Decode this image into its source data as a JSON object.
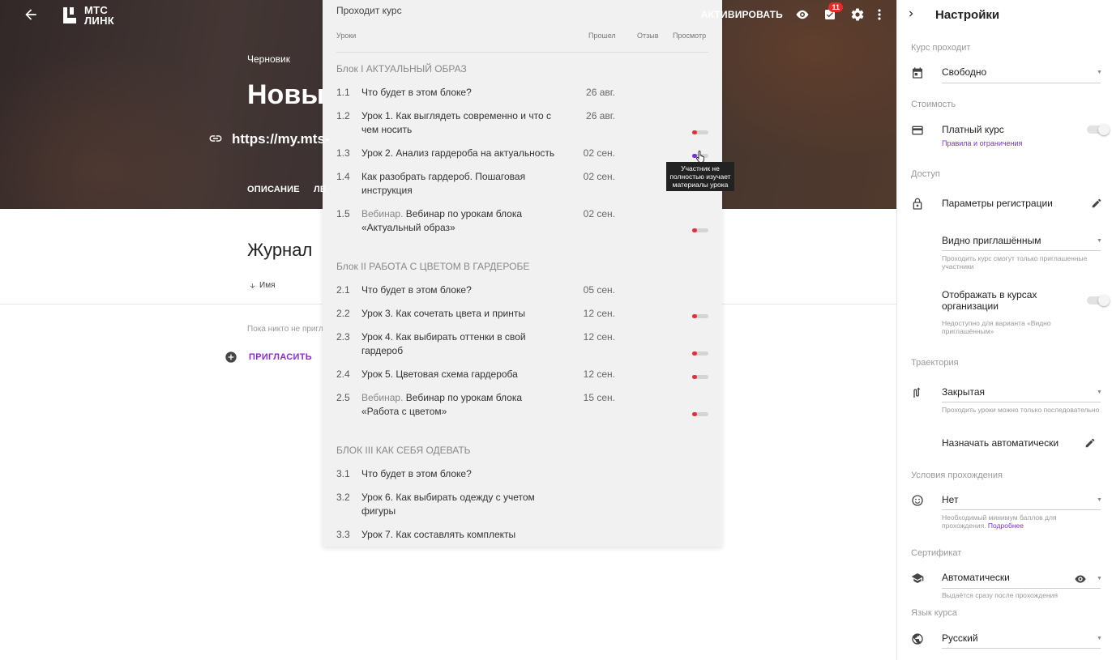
{
  "hero": {
    "logo": [
      "МТС",
      "ЛИНК"
    ],
    "draft_label": "Черновик",
    "course_title": "Новы",
    "course_url": "https://my.mts-",
    "tabs": [
      "ОПИСАНИЕ",
      "ЛЕ"
    ],
    "activate_label": "АКТИВИРОВАТЬ",
    "notification_count": "11"
  },
  "main": {
    "journal_title": "Журнал",
    "sort_label": "Имя",
    "empty_text": "Пока никто не пригл",
    "invite_label": "ПРИГЛАСИТЬ"
  },
  "panel": {
    "title": "Проходит курс",
    "columns": {
      "lessons": "Уроки",
      "passed": "Прошел",
      "feedback": "Отзыв",
      "view": "Просмотр"
    },
    "blocks": [
      {
        "title": "Блок I АКТУАЛЬНЫЙ ОБРАЗ",
        "lessons": [
          {
            "num": "1.1",
            "tag": "",
            "name": "Что будет в этом блоке?",
            "date": "26 авг.",
            "toggle": false
          },
          {
            "num": "1.2",
            "tag": "",
            "name": "Урок 1. Как выглядеть современно и что с чем носить",
            "date": "26 авг.",
            "toggle": true
          },
          {
            "num": "1.3",
            "tag": "",
            "name": "Урок 2. Анализ гардероба на актуальность",
            "date": "02 сен.",
            "toggle": true,
            "active": true
          },
          {
            "num": "1.4",
            "tag": "",
            "name": "Как разобрать гардероб. Пошаговая инструкция",
            "date": "02 сен.",
            "toggle": false
          },
          {
            "num": "1.5",
            "tag": "Вебинар.",
            "name": "Вебинар по урокам блока «Актуальный образ»",
            "date": "02 сен.",
            "toggle": true
          }
        ]
      },
      {
        "title": "Блок II РАБОТА С ЦВЕТОМ В ГАРДЕРОБЕ",
        "lessons": [
          {
            "num": "2.1",
            "tag": "",
            "name": "Что будет в этом блоке?",
            "date": "05 сен.",
            "toggle": false
          },
          {
            "num": "2.2",
            "tag": "",
            "name": "Урок 3. Как сочетать цвета и принты",
            "date": "12 сен.",
            "toggle": true
          },
          {
            "num": "2.3",
            "tag": "",
            "name": "Урок 4. Как выбирать оттенки в свой гардероб",
            "date": "12 сен.",
            "toggle": true
          },
          {
            "num": "2.4",
            "tag": "",
            "name": "Урок 5. Цветовая схема гардероба",
            "date": "12 сен.",
            "toggle": true
          },
          {
            "num": "2.5",
            "tag": "Вебинар.",
            "name": "Вебинар по урокам блока «Работа с цветом»",
            "date": "15 сен.",
            "toggle": true
          }
        ]
      },
      {
        "title": "БЛОК III КАК СЕБЯ ОДЕВАТЬ",
        "lessons": [
          {
            "num": "3.1",
            "tag": "",
            "name": "Что будет в этом блоке?",
            "date": "",
            "toggle": false
          },
          {
            "num": "3.2",
            "tag": "",
            "name": "Урок 6. Как выбирать одежду с учетом фигуры",
            "date": "",
            "toggle": false
          },
          {
            "num": "3.3",
            "tag": "",
            "name": "Урок 7. Как составлять комплекты",
            "date": "",
            "toggle": false
          }
        ]
      }
    ],
    "tooltip": "Участник не полностью изучает материалы урока"
  },
  "settings": {
    "title": "Настройки",
    "course_passes_label": "Курс проходит",
    "course_passes_value": "Свободно",
    "cost_label": "Стоимость",
    "paid_label": "Платный курс",
    "paid_rules_link": "Правила и ограничения",
    "access_label": "Доступ",
    "registration_label": "Параметры регистрации",
    "visibility_value": "Видно приглашённым",
    "visibility_hint": "Проходить курс смогут только приглашенные участники",
    "show_in_org_label": "Отображать в курсах организации",
    "show_in_org_hint": "Недоступно для варианта «Видно приглашённым»",
    "trajectory_label": "Траектория",
    "trajectory_value": "Закрытая",
    "trajectory_hint": "Проходить уроки можно только последовательно",
    "auto_assign_label": "Назначать автоматически",
    "conditions_label": "Условия прохождения",
    "conditions_value": "Нет",
    "conditions_hint": "Необходимый минимум баллов для прохождения.",
    "conditions_more": "Подробнее",
    "certificate_label": "Сертификат",
    "certificate_value": "Автоматически",
    "certificate_hint": "Выдаётся сразу после прохождения",
    "language_label": "Язык курса",
    "language_value": "Русский"
  },
  "colors": {
    "accent": "#8b2bd6",
    "toggle_red": "#e0303a",
    "panel_bg": "#f1f1f1"
  }
}
